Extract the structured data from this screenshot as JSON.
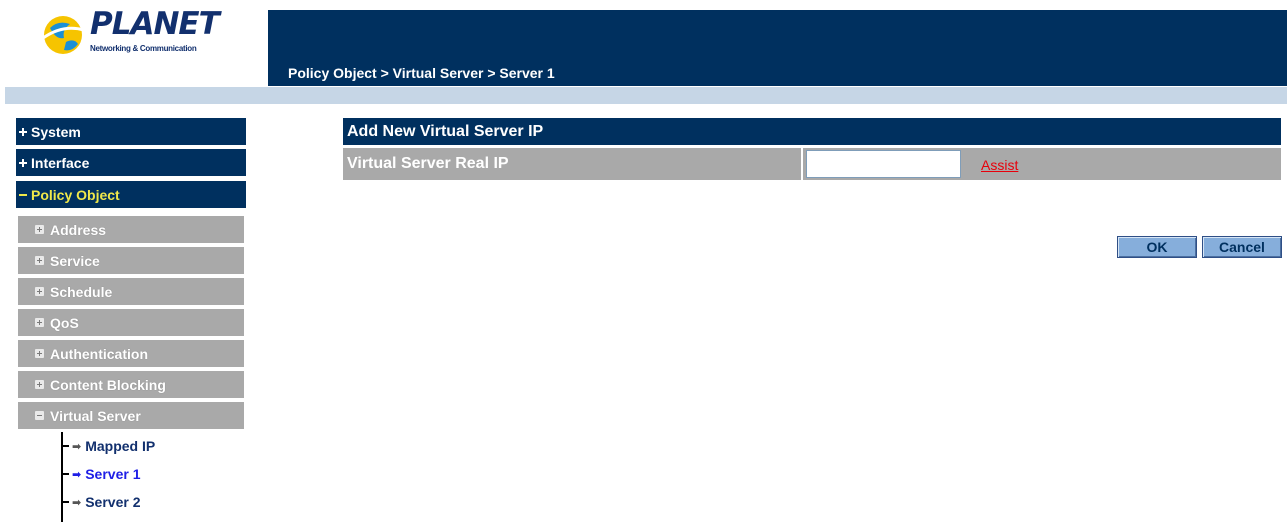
{
  "logo": {
    "text": "PLANET",
    "subtext": "Networking & Communication"
  },
  "header": {
    "breadcrumb": "Policy Object > Virtual Server > Server 1"
  },
  "sidebar": {
    "top_items": [
      {
        "label": "System",
        "expanded": false
      },
      {
        "label": "Interface",
        "expanded": false
      },
      {
        "label": "Policy Object",
        "expanded": true
      }
    ],
    "sub_items": [
      {
        "label": "Address",
        "expanded": false
      },
      {
        "label": "Service",
        "expanded": false
      },
      {
        "label": "Schedule",
        "expanded": false
      },
      {
        "label": "QoS",
        "expanded": false
      },
      {
        "label": "Authentication",
        "expanded": false
      },
      {
        "label": "Content Blocking",
        "expanded": false
      },
      {
        "label": "Virtual Server",
        "expanded": true
      }
    ],
    "tree_items": [
      {
        "label": "Mapped IP",
        "current": false
      },
      {
        "label": "Server 1",
        "current": true
      },
      {
        "label": "Server 2",
        "current": false
      }
    ]
  },
  "form": {
    "title": "Add New Virtual Server IP",
    "real_ip_label": "Virtual Server Real IP",
    "real_ip_value": "",
    "assist_label": "Assist"
  },
  "buttons": {
    "ok": "OK",
    "cancel": "Cancel"
  },
  "colors": {
    "header_navy": "#00305f",
    "sidebar_gray": "#a9a9a9",
    "active_yellow": "#f0e84a",
    "link_red": "#e8000b",
    "button_blue": "#86aedb"
  }
}
